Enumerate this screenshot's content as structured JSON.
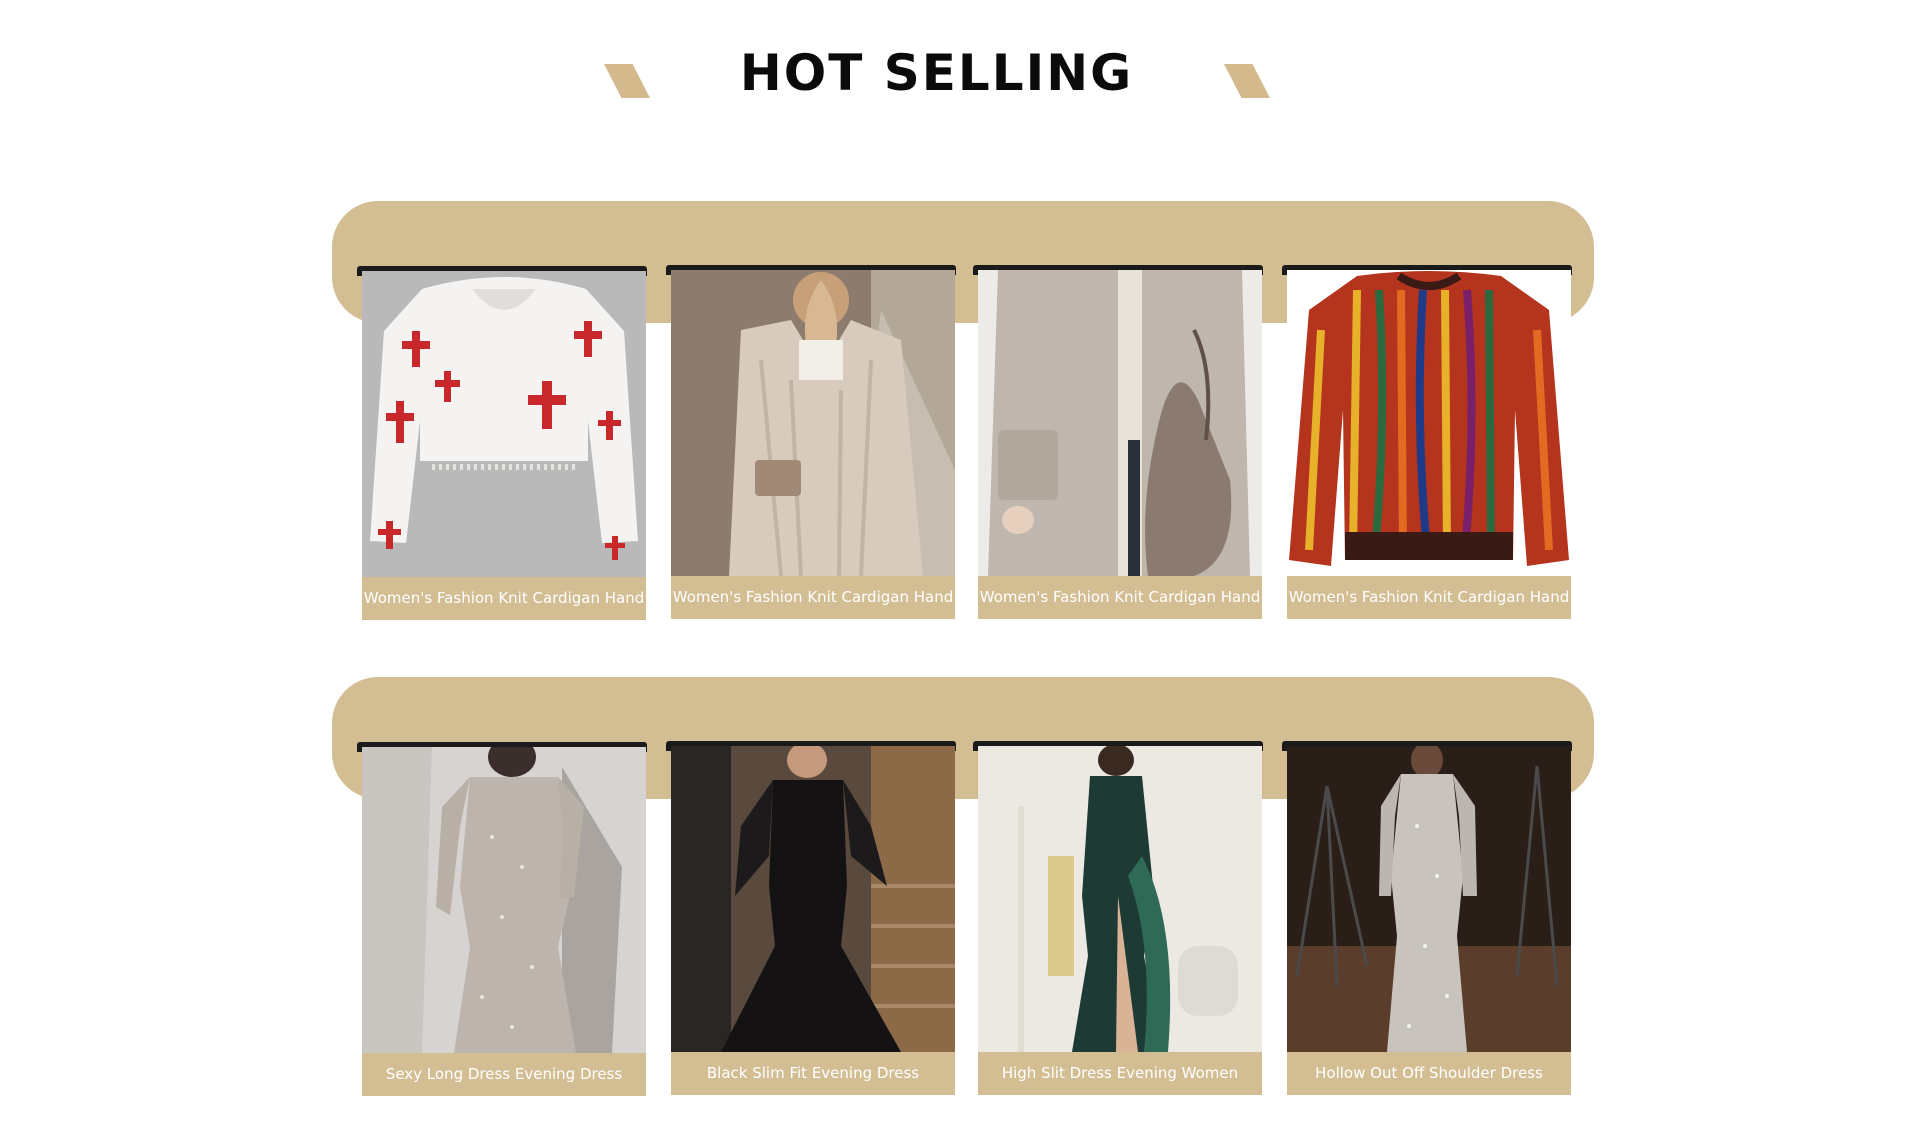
{
  "section": {
    "title": "HOT SELLING"
  },
  "rows": [
    {
      "products": [
        {
          "name": "Women's Fashion Knit Cardigan Hand",
          "image": "white-cropped-sweater-red-crosses"
        },
        {
          "name": "Women's Fashion Knit Cardigan Hand",
          "image": "beige-cable-knit-long-cardigan"
        },
        {
          "name": "Women's Fashion Knit Cardigan Hand",
          "image": "grey-long-coat-cardigan"
        },
        {
          "name": "Women's Fashion Knit Cardigan Hand",
          "image": "multicolor-patterned-sweater"
        }
      ]
    },
    {
      "products": [
        {
          "name": "Sexy Long Dress Evening Dress",
          "image": "silver-sequin-long-sleeve-gown"
        },
        {
          "name": "Black Slim Fit Evening Dress",
          "image": "black-lace-mermaid-gown"
        },
        {
          "name": "High Slit Dress Evening Women",
          "image": "green-sequin-feather-slit-gown"
        },
        {
          "name": "Hollow Out Off Shoulder Dress",
          "image": "silver-sparkle-hollow-gown"
        }
      ]
    }
  ],
  "colors": {
    "accent": "#d3bd93",
    "title": "#0b0b0b",
    "rail": "#1a1a1a",
    "caption_text": "#ffffff"
  }
}
